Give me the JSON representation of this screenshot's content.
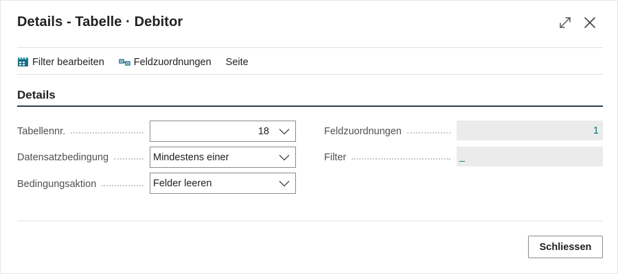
{
  "dialog": {
    "title": "Details - Tabelle · Debitor",
    "expand_icon": "expand-icon",
    "close_icon": "close-icon"
  },
  "actions": [
    {
      "label": "Filter bearbeiten",
      "icon": "filter-edit-icon"
    },
    {
      "label": "Feldzuordnungen",
      "icon": "field-mapping-icon"
    },
    {
      "label": "Seite",
      "icon": ""
    }
  ],
  "section": {
    "title": "Details"
  },
  "fields_left": [
    {
      "label": "Tabellennr.",
      "value": "18"
    },
    {
      "label": "Datensatzbedingung",
      "value": "Mindestens einer"
    },
    {
      "label": "Bedingungsaktion",
      "value": "Felder leeren"
    }
  ],
  "fields_right": [
    {
      "label": "Feldzuordnungen",
      "value": "1"
    },
    {
      "label": "Filter",
      "value": "_"
    }
  ],
  "footer": {
    "close_button": "Schliessen"
  },
  "colors": {
    "link_value": "#00756f",
    "section_rule": "#2c3e50",
    "readonly_bg": "#ebebeb"
  }
}
